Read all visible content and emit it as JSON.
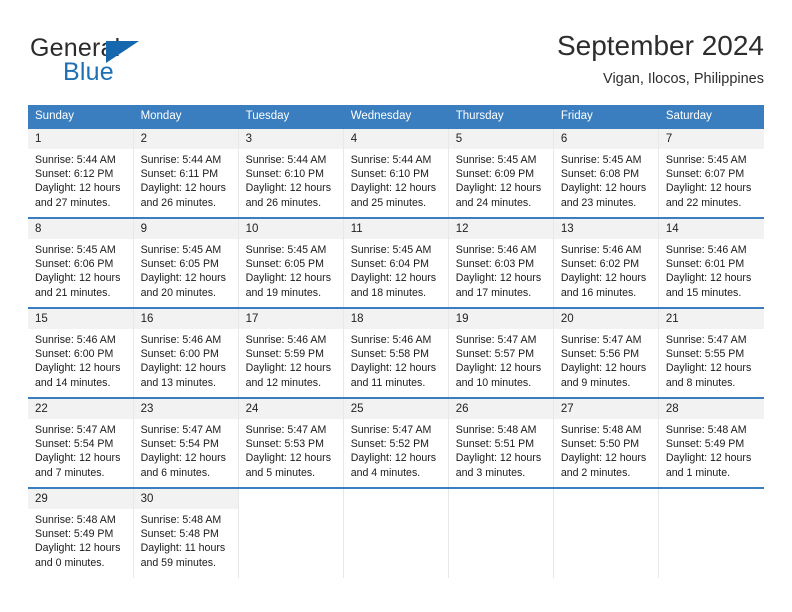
{
  "brand": {
    "name_part1": "General",
    "name_part2": "Blue",
    "accent_color": "#1567ae"
  },
  "header": {
    "title": "September 2024",
    "subtitle": "Vigan, Ilocos, Philippines"
  },
  "calendar": {
    "header_bg": "#3a7ebf",
    "weekdays": [
      "Sunday",
      "Monday",
      "Tuesday",
      "Wednesday",
      "Thursday",
      "Friday",
      "Saturday"
    ],
    "weeks": [
      [
        {
          "day": "1",
          "sunrise": "Sunrise: 5:44 AM",
          "sunset": "Sunset: 6:12 PM",
          "daylight_line1": "Daylight: 12 hours",
          "daylight_line2": "and 27 minutes."
        },
        {
          "day": "2",
          "sunrise": "Sunrise: 5:44 AM",
          "sunset": "Sunset: 6:11 PM",
          "daylight_line1": "Daylight: 12 hours",
          "daylight_line2": "and 26 minutes."
        },
        {
          "day": "3",
          "sunrise": "Sunrise: 5:44 AM",
          "sunset": "Sunset: 6:10 PM",
          "daylight_line1": "Daylight: 12 hours",
          "daylight_line2": "and 26 minutes."
        },
        {
          "day": "4",
          "sunrise": "Sunrise: 5:44 AM",
          "sunset": "Sunset: 6:10 PM",
          "daylight_line1": "Daylight: 12 hours",
          "daylight_line2": "and 25 minutes."
        },
        {
          "day": "5",
          "sunrise": "Sunrise: 5:45 AM",
          "sunset": "Sunset: 6:09 PM",
          "daylight_line1": "Daylight: 12 hours",
          "daylight_line2": "and 24 minutes."
        },
        {
          "day": "6",
          "sunrise": "Sunrise: 5:45 AM",
          "sunset": "Sunset: 6:08 PM",
          "daylight_line1": "Daylight: 12 hours",
          "daylight_line2": "and 23 minutes."
        },
        {
          "day": "7",
          "sunrise": "Sunrise: 5:45 AM",
          "sunset": "Sunset: 6:07 PM",
          "daylight_line1": "Daylight: 12 hours",
          "daylight_line2": "and 22 minutes."
        }
      ],
      [
        {
          "day": "8",
          "sunrise": "Sunrise: 5:45 AM",
          "sunset": "Sunset: 6:06 PM",
          "daylight_line1": "Daylight: 12 hours",
          "daylight_line2": "and 21 minutes."
        },
        {
          "day": "9",
          "sunrise": "Sunrise: 5:45 AM",
          "sunset": "Sunset: 6:05 PM",
          "daylight_line1": "Daylight: 12 hours",
          "daylight_line2": "and 20 minutes."
        },
        {
          "day": "10",
          "sunrise": "Sunrise: 5:45 AM",
          "sunset": "Sunset: 6:05 PM",
          "daylight_line1": "Daylight: 12 hours",
          "daylight_line2": "and 19 minutes."
        },
        {
          "day": "11",
          "sunrise": "Sunrise: 5:45 AM",
          "sunset": "Sunset: 6:04 PM",
          "daylight_line1": "Daylight: 12 hours",
          "daylight_line2": "and 18 minutes."
        },
        {
          "day": "12",
          "sunrise": "Sunrise: 5:46 AM",
          "sunset": "Sunset: 6:03 PM",
          "daylight_line1": "Daylight: 12 hours",
          "daylight_line2": "and 17 minutes."
        },
        {
          "day": "13",
          "sunrise": "Sunrise: 5:46 AM",
          "sunset": "Sunset: 6:02 PM",
          "daylight_line1": "Daylight: 12 hours",
          "daylight_line2": "and 16 minutes."
        },
        {
          "day": "14",
          "sunrise": "Sunrise: 5:46 AM",
          "sunset": "Sunset: 6:01 PM",
          "daylight_line1": "Daylight: 12 hours",
          "daylight_line2": "and 15 minutes."
        }
      ],
      [
        {
          "day": "15",
          "sunrise": "Sunrise: 5:46 AM",
          "sunset": "Sunset: 6:00 PM",
          "daylight_line1": "Daylight: 12 hours",
          "daylight_line2": "and 14 minutes."
        },
        {
          "day": "16",
          "sunrise": "Sunrise: 5:46 AM",
          "sunset": "Sunset: 6:00 PM",
          "daylight_line1": "Daylight: 12 hours",
          "daylight_line2": "and 13 minutes."
        },
        {
          "day": "17",
          "sunrise": "Sunrise: 5:46 AM",
          "sunset": "Sunset: 5:59 PM",
          "daylight_line1": "Daylight: 12 hours",
          "daylight_line2": "and 12 minutes."
        },
        {
          "day": "18",
          "sunrise": "Sunrise: 5:46 AM",
          "sunset": "Sunset: 5:58 PM",
          "daylight_line1": "Daylight: 12 hours",
          "daylight_line2": "and 11 minutes."
        },
        {
          "day": "19",
          "sunrise": "Sunrise: 5:47 AM",
          "sunset": "Sunset: 5:57 PM",
          "daylight_line1": "Daylight: 12 hours",
          "daylight_line2": "and 10 minutes."
        },
        {
          "day": "20",
          "sunrise": "Sunrise: 5:47 AM",
          "sunset": "Sunset: 5:56 PM",
          "daylight_line1": "Daylight: 12 hours",
          "daylight_line2": "and 9 minutes."
        },
        {
          "day": "21",
          "sunrise": "Sunrise: 5:47 AM",
          "sunset": "Sunset: 5:55 PM",
          "daylight_line1": "Daylight: 12 hours",
          "daylight_line2": "and 8 minutes."
        }
      ],
      [
        {
          "day": "22",
          "sunrise": "Sunrise: 5:47 AM",
          "sunset": "Sunset: 5:54 PM",
          "daylight_line1": "Daylight: 12 hours",
          "daylight_line2": "and 7 minutes."
        },
        {
          "day": "23",
          "sunrise": "Sunrise: 5:47 AM",
          "sunset": "Sunset: 5:54 PM",
          "daylight_line1": "Daylight: 12 hours",
          "daylight_line2": "and 6 minutes."
        },
        {
          "day": "24",
          "sunrise": "Sunrise: 5:47 AM",
          "sunset": "Sunset: 5:53 PM",
          "daylight_line1": "Daylight: 12 hours",
          "daylight_line2": "and 5 minutes."
        },
        {
          "day": "25",
          "sunrise": "Sunrise: 5:47 AM",
          "sunset": "Sunset: 5:52 PM",
          "daylight_line1": "Daylight: 12 hours",
          "daylight_line2": "and 4 minutes."
        },
        {
          "day": "26",
          "sunrise": "Sunrise: 5:48 AM",
          "sunset": "Sunset: 5:51 PM",
          "daylight_line1": "Daylight: 12 hours",
          "daylight_line2": "and 3 minutes."
        },
        {
          "day": "27",
          "sunrise": "Sunrise: 5:48 AM",
          "sunset": "Sunset: 5:50 PM",
          "daylight_line1": "Daylight: 12 hours",
          "daylight_line2": "and 2 minutes."
        },
        {
          "day": "28",
          "sunrise": "Sunrise: 5:48 AM",
          "sunset": "Sunset: 5:49 PM",
          "daylight_line1": "Daylight: 12 hours",
          "daylight_line2": "and 1 minute."
        }
      ],
      [
        {
          "day": "29",
          "sunrise": "Sunrise: 5:48 AM",
          "sunset": "Sunset: 5:49 PM",
          "daylight_line1": "Daylight: 12 hours",
          "daylight_line2": "and 0 minutes."
        },
        {
          "day": "30",
          "sunrise": "Sunrise: 5:48 AM",
          "sunset": "Sunset: 5:48 PM",
          "daylight_line1": "Daylight: 11 hours",
          "daylight_line2": "and 59 minutes."
        },
        {
          "day": "",
          "sunrise": "",
          "sunset": "",
          "daylight_line1": "",
          "daylight_line2": ""
        },
        {
          "day": "",
          "sunrise": "",
          "sunset": "",
          "daylight_line1": "",
          "daylight_line2": ""
        },
        {
          "day": "",
          "sunrise": "",
          "sunset": "",
          "daylight_line1": "",
          "daylight_line2": ""
        },
        {
          "day": "",
          "sunrise": "",
          "sunset": "",
          "daylight_line1": "",
          "daylight_line2": ""
        },
        {
          "day": "",
          "sunrise": "",
          "sunset": "",
          "daylight_line1": "",
          "daylight_line2": ""
        }
      ]
    ]
  }
}
